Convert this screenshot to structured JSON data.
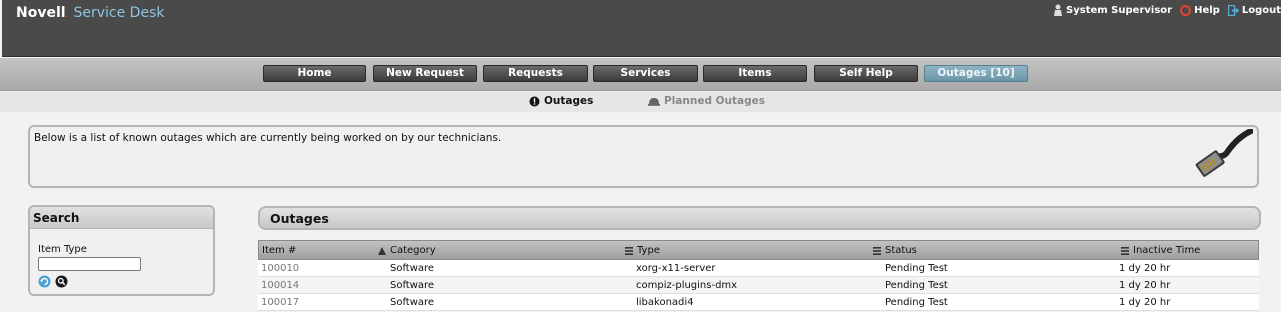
{
  "brand": {
    "name": "Novell",
    "dot": ".",
    "product": "Service Desk"
  },
  "user_nav": [
    {
      "label": "System Supervisor",
      "icon": "user-icon"
    },
    {
      "label": "Help",
      "icon": "help-lifebuoy-icon"
    },
    {
      "label": "Logout",
      "icon": "logout-icon"
    }
  ],
  "tabs": [
    {
      "label": "Home"
    },
    {
      "label": "New Request"
    },
    {
      "label": "Requests"
    },
    {
      "label": "Services"
    },
    {
      "label": "Items"
    },
    {
      "label": "Self Help"
    },
    {
      "label": "Outages [10]",
      "active": true
    }
  ],
  "subtabs": [
    {
      "label": "Outages",
      "icon": "alert-icon",
      "active": true
    },
    {
      "label": "Planned Outages",
      "icon": "hardhat-icon",
      "active": false
    }
  ],
  "info": {
    "text": "Below is a list of known outages which are currently being worked on by our technicians.",
    "image_icon": "network-cable-icon"
  },
  "search": {
    "title": "Search",
    "field_label": "Item Type",
    "field_value": "",
    "reset_icon": "refresh-icon",
    "search_icon": "magnifier-icon"
  },
  "outages": {
    "title": "Outages",
    "columns": [
      {
        "label": "Item #",
        "icon": ""
      },
      {
        "label": "Category",
        "icon": "sort-asc-icon"
      },
      {
        "label": "Type",
        "icon": "column-menu-icon"
      },
      {
        "label": "Status",
        "icon": "column-menu-icon"
      },
      {
        "label": "Inactive Time",
        "icon": "column-menu-icon"
      }
    ],
    "rows": [
      {
        "item": "100010",
        "category": "Software",
        "type": "xorg-x11-server",
        "status": "Pending Test",
        "inactive": "1 dy 20 hr"
      },
      {
        "item": "100014",
        "category": "Software",
        "type": "compiz-plugins-dmx",
        "status": "Pending Test",
        "inactive": "1 dy 20 hr"
      },
      {
        "item": "100017",
        "category": "Software",
        "type": "libakonadi4",
        "status": "Pending Test",
        "inactive": "1 dy 20 hr"
      }
    ]
  },
  "colors": {
    "header_bg": "#4a4a4a",
    "product_blue": "#8fc3e2",
    "active_tab": "#7aa3b4",
    "brand_dot_red": "#e0302a"
  }
}
